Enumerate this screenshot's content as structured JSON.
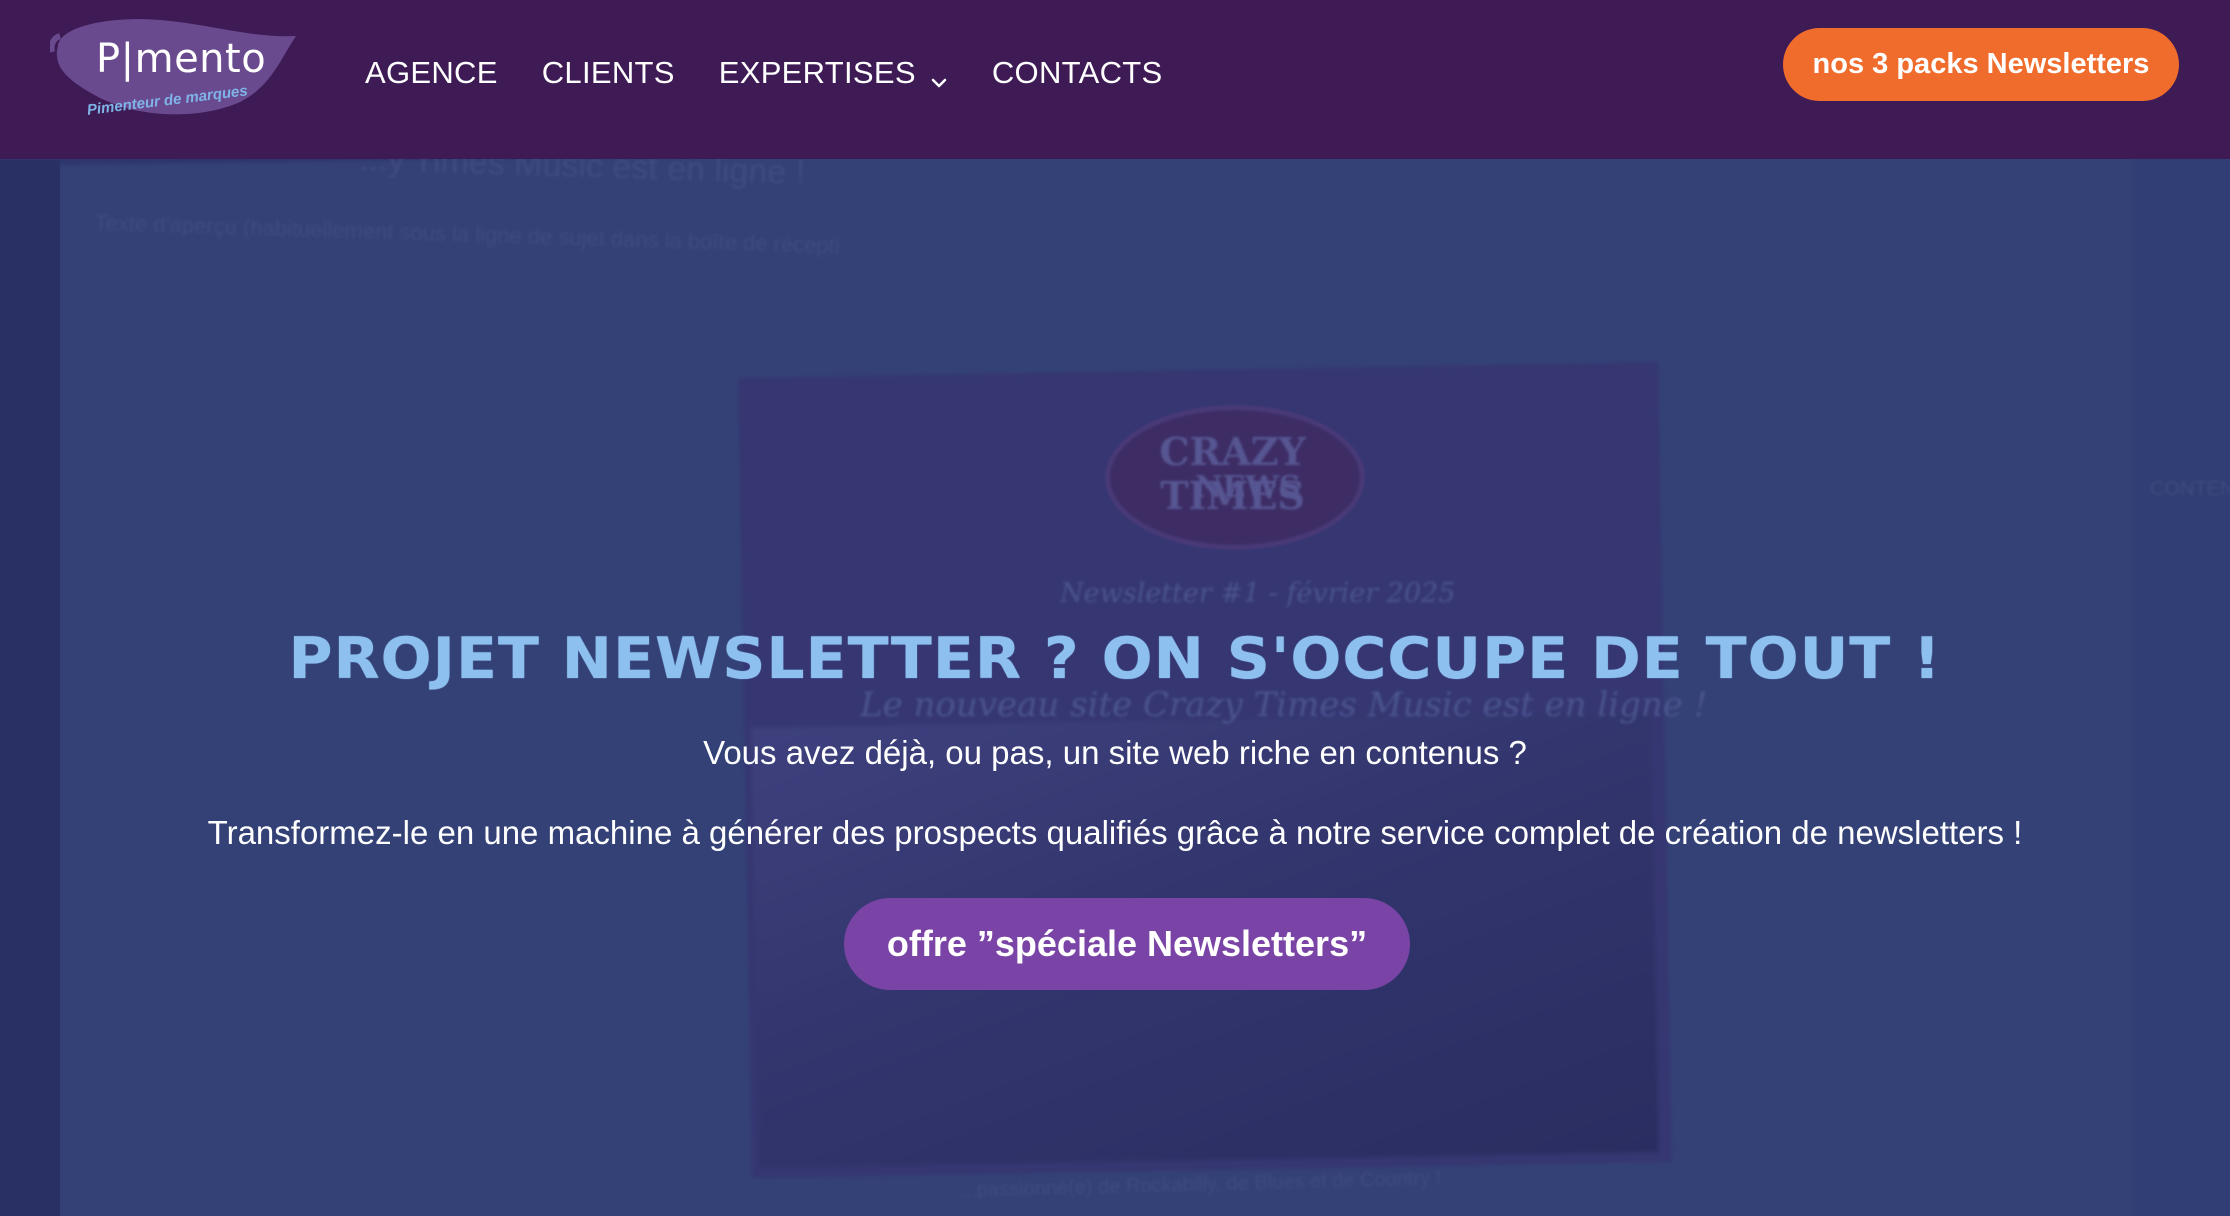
{
  "brand": {
    "name": "P|mento",
    "tagline": "Pimenteur de marques",
    "colors": {
      "nav_bg": "#3e1b55",
      "orange": "#ef6c2c",
      "purple_button": "#7a44a6",
      "title_blue": "#8dc0ef"
    }
  },
  "nav": {
    "items": [
      {
        "label": "AGENCE"
      },
      {
        "label": "CLIENTS"
      },
      {
        "label": "EXPERTISES",
        "icon": "chevron-down-icon"
      },
      {
        "label": "CONTACTS"
      }
    ],
    "cta_label": "nos 3 packs Newsletters"
  },
  "background": {
    "editor_subject": "...y Times Music est en ligne !",
    "editor_preview": "Texte d'aperçu (habituellement sous la ligne de sujet dans la boîte de récepti",
    "newsletter_logo_line1": "CRAZY TIMES",
    "newsletter_logo_line2": "NEWS",
    "newsletter_date": "Newsletter #1 - février 2025",
    "newsletter_headline": "Le nouveau site Crazy Times Music est en ligne !",
    "newsletter_footer": "...passionné(e) de Rockabilly, de Blues et de Country !",
    "sidebar_label": "CONTEN"
  },
  "hero": {
    "title": "PROJET NEWSLETTER ? ON S'OCCUPE DE TOUT !",
    "subtitle1": "Vous avez déjà, ou pas, un site web riche en contenus ?",
    "subtitle2": "Transformez-le en une machine à générer des prospects qualifiés grâce à notre service complet de création de newsletters !",
    "cta_label": "offre ”spéciale Newsletters”"
  }
}
